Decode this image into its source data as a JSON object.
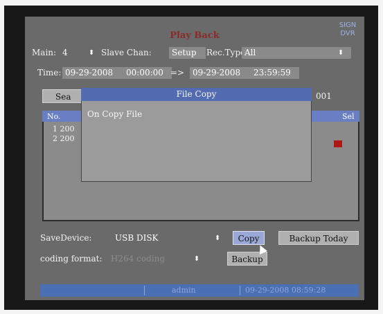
{
  "title": "Play Back",
  "logo_text": "SIGN DVR",
  "row1": {
    "main_label": "Main:",
    "main_value": "4",
    "slave_label": "Slave Chan:",
    "slave_value": "Setup",
    "rec_type_label": "Rec.Type",
    "rec_type_value": "All"
  },
  "time_row": {
    "label": "Time:",
    "start_date": "09-29-2008",
    "start_time": "00:00:00",
    "separator": "=>",
    "end_date": "09-29-2008",
    "end_time": "23:59:59"
  },
  "search_partial": "Sea",
  "right_partial": "001",
  "list": {
    "columns": [
      "No.",
      "Sel"
    ],
    "rows": [
      {
        "text": "1 200",
        "selected": false
      },
      {
        "text": "2 200",
        "selected": true
      }
    ]
  },
  "dialog": {
    "title": "File Copy",
    "message": "On Copy File"
  },
  "bottom": {
    "save_device_label": "SaveDevice:",
    "save_device_value": "USB DISK",
    "copy_button": "Copy",
    "backup_today_button": "Backup Today",
    "coding_label": "coding format:",
    "coding_value": "H264 coding",
    "backup_button": "Backup"
  },
  "status_bar": {
    "user": "admin",
    "datetime": "09-29-2008 08:59:28"
  },
  "colors": {
    "accent": "#536bb0",
    "panel": "#6a6a6a",
    "selected_check": "#b01717"
  }
}
